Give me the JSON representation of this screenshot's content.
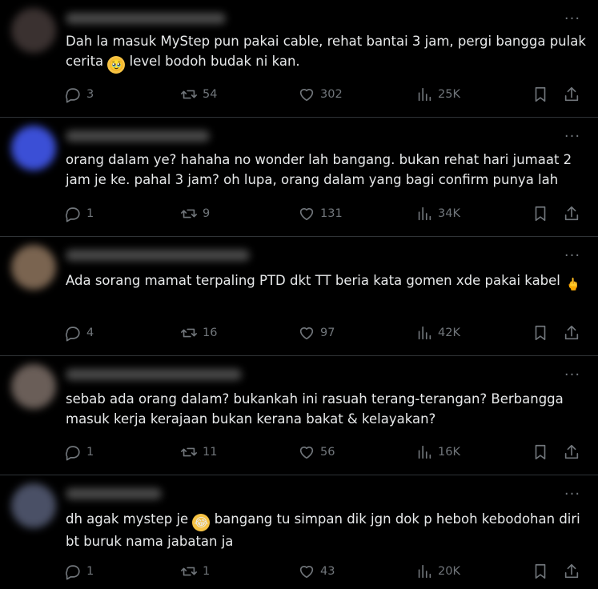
{
  "tweets": [
    {
      "text": "Dah la masuk MyStep pun pakai cable, rehat bantai 3 jam, pergi bangga pulak cerita",
      "emoji": "🥹",
      "text_after": " level bodoh budak ni kan.",
      "replies": "3",
      "reposts": "54",
      "likes": "302",
      "views": "25K"
    },
    {
      "text": "orang dalam ye? hahaha no wonder lah bangang. bukan rehat hari jumaat 2 jam je ke. pahal 3 jam? oh lupa, orang dalam yang bagi confirm punya lah",
      "emoji": "",
      "text_after": "",
      "replies": "1",
      "reposts": "9",
      "likes": "131",
      "views": "34K"
    },
    {
      "text": "Ada sorang mamat terpaling PTD dkt TT beria kata gomen xde pakai kabel",
      "emoji": "🖕",
      "text_after": "",
      "replies": "4",
      "reposts": "16",
      "likes": "97",
      "views": "42K"
    },
    {
      "text": "sebab ada orang dalam?  bukankah ini rasuah terang-terangan? Berbangga masuk kerja kerajaan bukan kerana bakat & kelayakan?",
      "emoji": "",
      "text_after": "",
      "replies": "1",
      "reposts": "11",
      "likes": "56",
      "views": "16K"
    },
    {
      "text": "dh agak mystep je",
      "emoji": "😂",
      "text_after": " bangang tu simpan dik jgn dok p heboh kebodohan diri bt buruk nama jabatan ja",
      "replies": "1",
      "reposts": "1",
      "likes": "43",
      "views": "20K"
    }
  ],
  "more_glyph": "···",
  "icons": [
    "reply-icon",
    "repost-icon",
    "like-icon",
    "views-icon",
    "bookmark-icon",
    "share-icon"
  ],
  "colors": {
    "background": "#000000",
    "text": "#e7e9ea",
    "muted": "#71767b",
    "divider": "#2f3336"
  }
}
